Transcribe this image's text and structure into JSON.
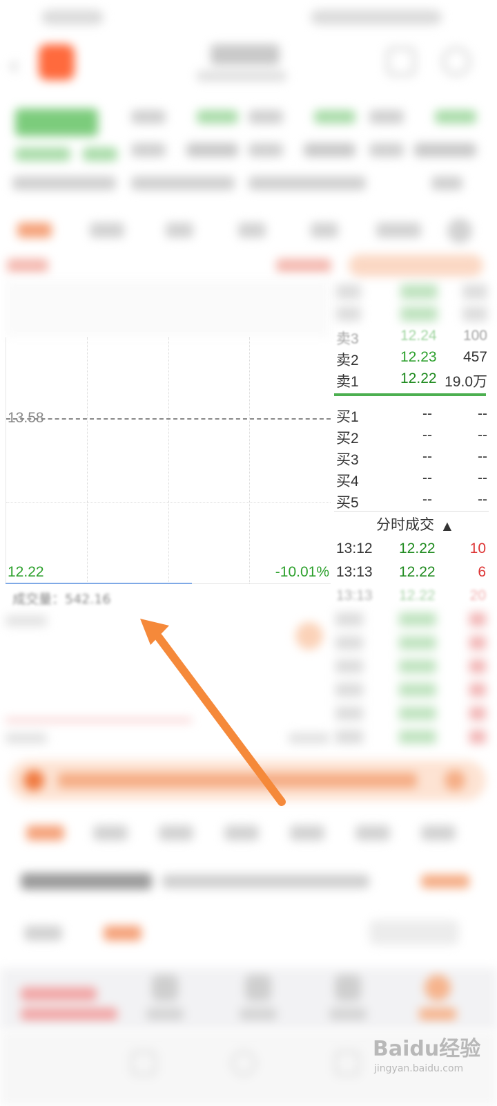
{
  "chart": {
    "ref_price": "13.58",
    "low_price": "12.22",
    "change_pct": "-10.01%"
  },
  "volume": {
    "label": "成交量：542.16"
  },
  "order_book": {
    "sell": [
      {
        "label": "卖3",
        "price": "12.24",
        "vol": "100"
      },
      {
        "label": "卖2",
        "price": "12.23",
        "vol": "457"
      },
      {
        "label": "卖1",
        "price": "12.22",
        "vol": "19.0万"
      }
    ],
    "buy": [
      {
        "label": "买1",
        "price": "--",
        "vol": "--"
      },
      {
        "label": "买2",
        "price": "--",
        "vol": "--"
      },
      {
        "label": "买3",
        "price": "--",
        "vol": "--"
      },
      {
        "label": "买4",
        "price": "--",
        "vol": "--"
      },
      {
        "label": "买5",
        "price": "--",
        "vol": "--"
      }
    ]
  },
  "trades": {
    "title": "分时成交",
    "rows": [
      {
        "time": "13:12",
        "price": "12.22",
        "vol": "10"
      },
      {
        "time": "13:13",
        "price": "12.22",
        "vol": "6"
      },
      {
        "time": "13:13",
        "price": "12.22",
        "vol": "20"
      }
    ]
  },
  "colors": {
    "price_green": "#2ca02c",
    "volume_red": "#d33333",
    "accent_orange": "#ff6a3d",
    "arrow_orange": "#f5893a"
  },
  "watermark": {
    "main": "Baidu经验",
    "sub": "jingyan.baidu.com"
  }
}
